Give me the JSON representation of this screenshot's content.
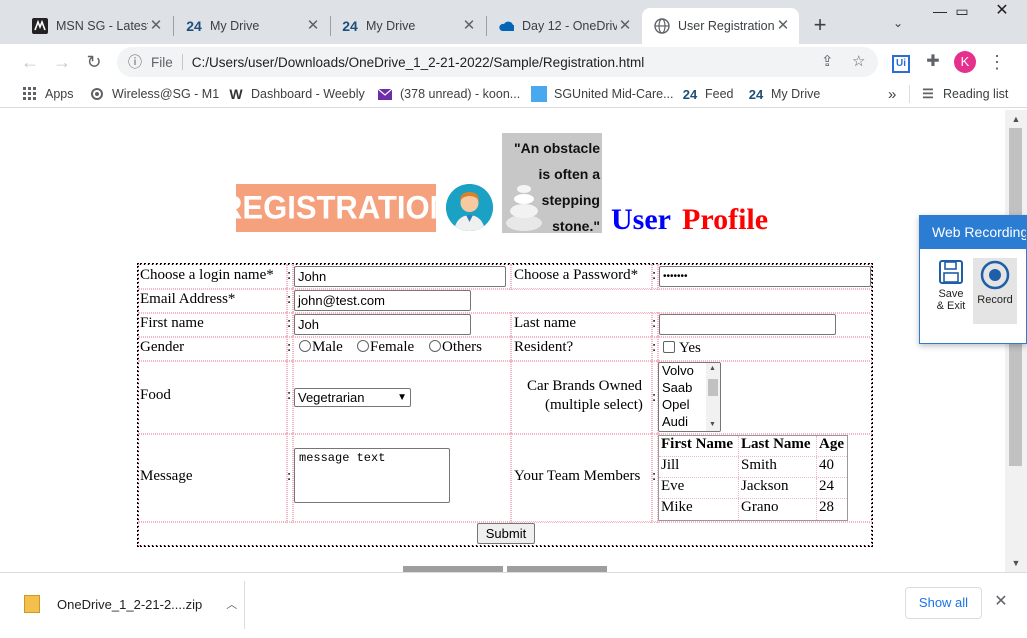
{
  "browser": {
    "tabs": [
      {
        "title": "MSN SG - Latest",
        "icon": "msn-icon"
      },
      {
        "title": "My Drive",
        "icon": "drive-24-icon"
      },
      {
        "title": "My Drive",
        "icon": "drive-24-icon"
      },
      {
        "title": "Day 12 - OneDriv",
        "icon": "onedrive-cloud-icon"
      },
      {
        "title": "User Registration",
        "icon": "globe-icon",
        "active": true
      }
    ],
    "new_tab": "+",
    "address": {
      "scheme": "File",
      "url": "C:/Users/user/Downloads/OneDrive_1_2-21-2022/Sample/Registration.html"
    },
    "profile_initial": "K",
    "profile_color": "#e5318d",
    "extension_label": "Ui",
    "bookmarks": [
      {
        "label": "Apps",
        "icon": "apps-grid-icon"
      },
      {
        "label": "Wireless@SG - M1",
        "icon": "globe-icon"
      },
      {
        "label": "Dashboard - Weebly",
        "icon": "weebly-w-icon"
      },
      {
        "label": "(378 unread) - koon...",
        "icon": "mail-icon"
      },
      {
        "label": "SGUnited Mid-Care...",
        "icon": "bookmark-square-icon"
      },
      {
        "label": "Feed",
        "icon": "drive-24-icon"
      },
      {
        "label": "My Drive",
        "icon": "drive-24-icon"
      }
    ],
    "overflow": "»",
    "reading_list": "Reading list"
  },
  "page": {
    "banner_text": "REGISTRATION",
    "quote_text": "\"An obstacle is often a stepping stone.\"",
    "title_part1": "User",
    "title_part2": "Profile",
    "title_colors": {
      "part1": "#0000ff",
      "part2": "#ff0000"
    },
    "form": {
      "login_label": "Choose a login name*",
      "login_value": "John",
      "password_label": "Choose a Password*",
      "password_value": "•••••••",
      "email_label": "Email Address*",
      "email_value": "john@test.com",
      "first_name_label": "First name",
      "first_name_value": "Joh",
      "last_name_label": "Last name",
      "last_name_value": "",
      "gender_label": "Gender",
      "gender_options": [
        "Male",
        "Female",
        "Others"
      ],
      "resident_label": "Resident?",
      "resident_option": "Yes",
      "food_label": "Food",
      "food_value": "Vegetrarian",
      "car_label_line1": "Car Brands Owned",
      "car_label_line2": "(multiple select)",
      "car_options": [
        "Volvo",
        "Saab",
        "Opel",
        "Audi"
      ],
      "message_label": "Message",
      "message_value": "message text",
      "team_label": "Your Team Members",
      "team_headers": [
        "First Name",
        "Last Name",
        "Age"
      ],
      "team_rows": [
        [
          "Jill",
          "Smith",
          "40"
        ],
        [
          "Eve",
          "Jackson",
          "24"
        ],
        [
          "Mike",
          "Grano",
          "28"
        ]
      ],
      "colon": ":",
      "submit_label": "Submit"
    }
  },
  "web_recording": {
    "title": "Web Recording",
    "save_exit_label_1": "Save",
    "save_exit_label_2": "& Exit",
    "record_label": "Record"
  },
  "downloads": {
    "file_name": "OneDrive_1_2-21-2....zip",
    "show_all": "Show all"
  }
}
